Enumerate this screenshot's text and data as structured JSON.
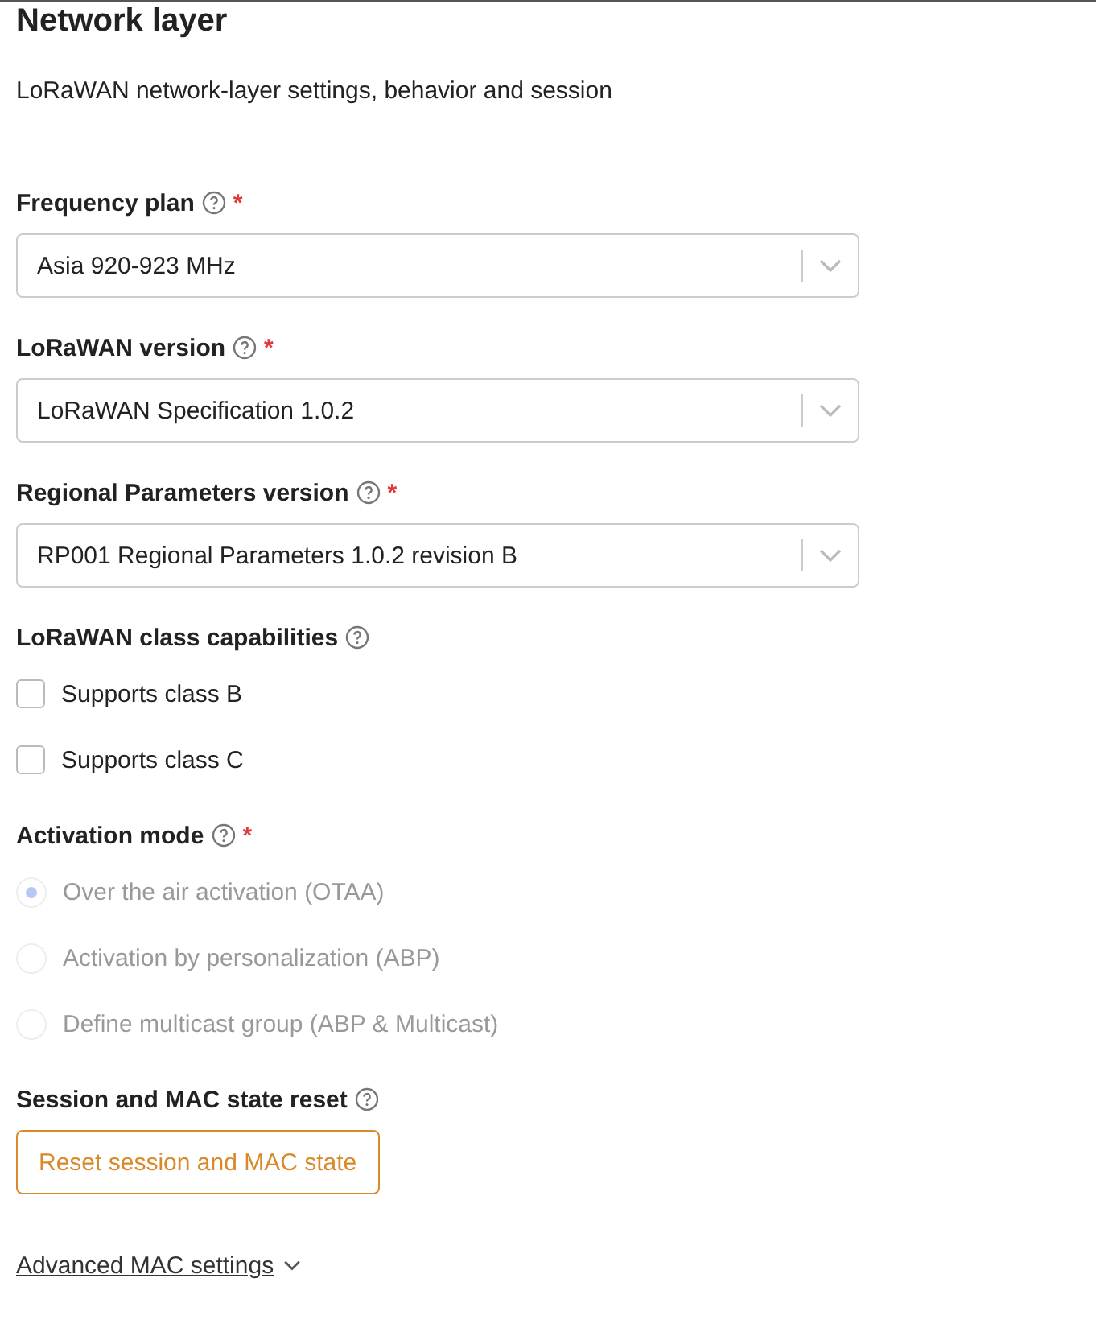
{
  "title": "Network layer",
  "description": "LoRaWAN network-layer settings, behavior and session",
  "selects": [
    {
      "label": "Frequency plan",
      "required_mark": "*",
      "value": "Asia 920-923 MHz"
    },
    {
      "label": "LoRaWAN version",
      "required_mark": "*",
      "value": "LoRaWAN Specification 1.0.2"
    },
    {
      "label": "Regional Parameters version",
      "required_mark": "*",
      "value": "RP001 Regional Parameters 1.0.2 revision B"
    }
  ],
  "capabilities": {
    "label": "LoRaWAN class capabilities",
    "options": [
      {
        "label": "Supports class B",
        "checked": false
      },
      {
        "label": "Supports class C",
        "checked": false
      }
    ]
  },
  "activation": {
    "label": "Activation mode",
    "required_mark": "*",
    "disabled": true,
    "options": [
      {
        "label": "Over the air activation (OTAA)",
        "selected": true
      },
      {
        "label": "Activation by personalization (ABP)",
        "selected": false
      },
      {
        "label": "Define multicast group (ABP & Multicast)",
        "selected": false
      }
    ]
  },
  "reset": {
    "label": "Session and MAC state reset",
    "button": "Reset session and MAC state"
  },
  "advanced": {
    "label": "Advanced MAC settings",
    "expanded": false
  }
}
